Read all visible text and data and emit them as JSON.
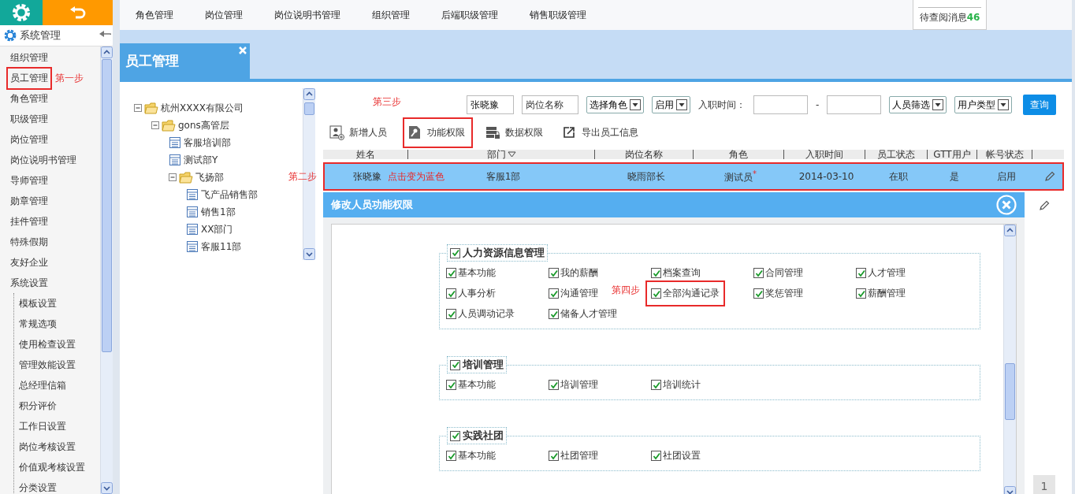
{
  "sidebar": {
    "title": "系统管理",
    "items": [
      {
        "label": "组织管理",
        "highlighted": false
      },
      {
        "label": "员工管理",
        "highlighted": true,
        "step_note": "第一步"
      },
      {
        "label": "角色管理",
        "highlighted": false
      },
      {
        "label": "职级管理",
        "highlighted": false
      },
      {
        "label": "岗位管理",
        "highlighted": false
      },
      {
        "label": "岗位说明书管理",
        "highlighted": false
      },
      {
        "label": "导师管理",
        "highlighted": false
      },
      {
        "label": "勋章管理",
        "highlighted": false
      },
      {
        "label": "挂件管理",
        "highlighted": false
      },
      {
        "label": "特殊假期",
        "highlighted": false
      },
      {
        "label": "友好企业",
        "highlighted": false
      },
      {
        "label": "系统设置",
        "highlighted": false,
        "children": [
          {
            "label": "模板设置"
          },
          {
            "label": "常规选项"
          },
          {
            "label": "使用检查设置"
          },
          {
            "label": "管理效能设置"
          },
          {
            "label": "总经理信箱"
          },
          {
            "label": "积分评价"
          },
          {
            "label": "工作日设置"
          },
          {
            "label": "岗位考核设置"
          },
          {
            "label": "价值观考核设置"
          },
          {
            "label": "分类设置"
          }
        ]
      }
    ]
  },
  "top_nav": [
    {
      "label": "角色管理"
    },
    {
      "label": "岗位管理"
    },
    {
      "label": "岗位说明书管理"
    },
    {
      "label": "组织管理"
    },
    {
      "label": "后端职级管理"
    },
    {
      "label": "销售职级管理"
    }
  ],
  "message_popup": {
    "label": "待查阅消息",
    "count": "46"
  },
  "page_tab": {
    "title": "员工管理"
  },
  "tree": {
    "label": "杭州XXXX有限公司",
    "kind": "folder",
    "expanded": true,
    "children": [
      {
        "label": "gons高管层",
        "kind": "folder",
        "expanded": true,
        "children": [
          {
            "label": "客服培训部",
            "kind": "dept"
          },
          {
            "label": "测试部Y",
            "kind": "dept"
          },
          {
            "label": "飞扬部",
            "kind": "folder",
            "expanded": true,
            "children": [
              {
                "label": "飞产品销售部",
                "kind": "dept"
              },
              {
                "label": "销售1部",
                "kind": "dept"
              },
              {
                "label": "XX部门",
                "kind": "dept"
              },
              {
                "label": "客服11部",
                "kind": "dept"
              }
            ]
          }
        ]
      }
    ]
  },
  "filters": {
    "name": "张晓豫",
    "position_placeholder": "岗位名称",
    "role_select": "选择角色",
    "status_select": "启用",
    "date_label": "入职时间：",
    "date_separator": "-",
    "staff_select": "人员筛选",
    "type_select": "用户类型",
    "search_button": "查询"
  },
  "actions": [
    {
      "label": "新增人员",
      "kind": "add-user",
      "highlighted": false
    },
    {
      "label": "功能权限",
      "kind": "key",
      "highlighted": true,
      "step_note": "第三步"
    },
    {
      "label": "数据权限",
      "kind": "data",
      "highlighted": false
    },
    {
      "label": "导出员工信息",
      "kind": "export",
      "highlighted": false
    }
  ],
  "table": {
    "columns": [
      {
        "label": "姓名"
      },
      {
        "label": "部门",
        "sortable": true
      },
      {
        "label": "岗位名称"
      },
      {
        "label": "角色"
      },
      {
        "label": "入职时间"
      },
      {
        "label": "员工状态"
      },
      {
        "label": "GTT用户"
      },
      {
        "label": "帐号状态"
      }
    ],
    "rows": [
      {
        "selected": true,
        "highlighted": true,
        "step_note": "第二步",
        "note": "点击变为蓝色",
        "cells": [
          "张晓豫",
          "客服1部",
          "晓雨部长",
          "测试员$^{*}$",
          "2014-03-10",
          "在职",
          "是",
          "启用"
        ]
      }
    ]
  },
  "permissions_panel": {
    "title": "修改人员功能权限",
    "groups": [
      {
        "label": "人力资源信息管理",
        "checked": true,
        "items": [
          {
            "label": "基本功能",
            "checked": true
          },
          {
            "label": "我的薪酬",
            "checked": true
          },
          {
            "label": "档案查询",
            "checked": true
          },
          {
            "label": "合同管理",
            "checked": true
          },
          {
            "label": "人才管理",
            "checked": true
          },
          {
            "label": "人事分析",
            "checked": true
          },
          {
            "label": "沟通管理",
            "checked": true
          },
          {
            "label": "全部沟通记录",
            "checked": true,
            "highlighted": true,
            "step_note": "第四步"
          },
          {
            "label": "奖惩管理",
            "checked": true
          },
          {
            "label": "薪酬管理",
            "checked": true
          },
          {
            "label": "人员调动记录",
            "checked": true
          },
          {
            "label": "储备人才管理",
            "checked": true
          }
        ]
      },
      {
        "label": "培训管理",
        "checked": true,
        "items": [
          {
            "label": "基本功能",
            "checked": true
          },
          {
            "label": "培训管理",
            "checked": true
          },
          {
            "label": "培训统计",
            "checked": true
          }
        ]
      },
      {
        "label": "实践社团",
        "checked": true,
        "items": [
          {
            "label": "基本功能",
            "checked": true
          },
          {
            "label": "社团管理",
            "checked": true
          },
          {
            "label": "社团设置",
            "checked": true
          }
        ]
      }
    ]
  },
  "page_number": "1"
}
